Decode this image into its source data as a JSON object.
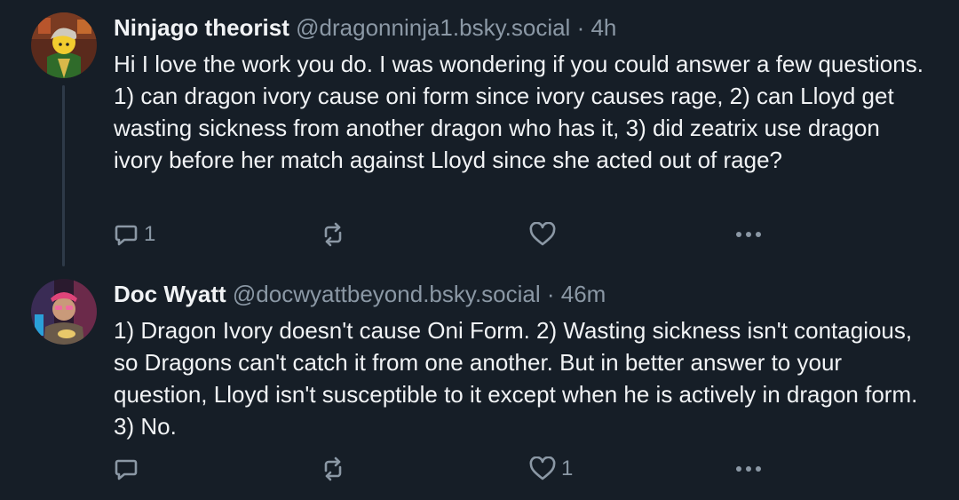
{
  "posts": [
    {
      "author": "Ninjago theorist",
      "handle": "@dragonninja1.bsky.social",
      "time": "· 4h",
      "text": "Hi I love the work you do. I was wondering if you could answer a few questions. 1) can dragon ivory cause oni form since ivory causes rage, 2) can Lloyd get wasting sickness from another dragon who has it, 3) did zeatrix use dragon ivory before her match against Lloyd since she acted out of rage?",
      "reply_count": "1",
      "repost_count": "",
      "like_count": ""
    },
    {
      "author": "Doc Wyatt",
      "handle": "@docwyattbeyond.bsky.social",
      "time": "· 46m",
      "text": "1) Dragon Ivory doesn't cause Oni Form. 2) Wasting sickness isn't contagious, so Dragons can't catch it from one another. But in better answer to your question, Lloyd isn't susceptible to it except when he is actively in dragon form. 3) No.",
      "reply_count": "",
      "repost_count": "",
      "like_count": "1"
    }
  ],
  "icons": {
    "reply": "reply-icon",
    "repost": "repost-icon",
    "like": "heart-icon",
    "more": "more-options-icon"
  },
  "colors": {
    "background": "#161e27",
    "text": "#f1f3f5",
    "muted": "#8b98a5",
    "thread_line": "#2e3a48"
  }
}
